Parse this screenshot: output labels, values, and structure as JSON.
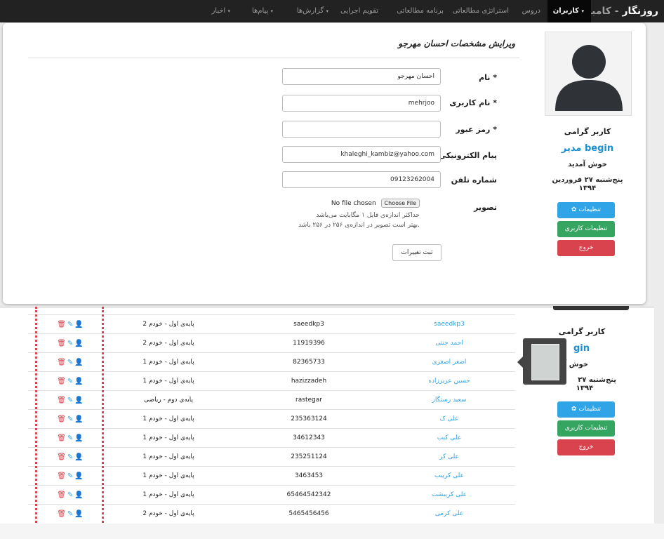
{
  "nav": {
    "brand_main": "روزنگار",
    "brand_sub": " - کامبیز",
    "items": [
      {
        "label": "کاربران",
        "caret": "▾",
        "active": true
      },
      {
        "label": "دروس",
        "caret": ""
      },
      {
        "label": "استراتژی مطالعاتی",
        "caret": ""
      },
      {
        "label": "برنامه مطالعاتی",
        "caret": ""
      },
      {
        "label": "تقویم اجرایی",
        "caret": ""
      },
      {
        "label": "گزارش‌ها",
        "caret": "▾"
      },
      {
        "label": "پیام‌ها",
        "caret": "▾"
      },
      {
        "label": "اخبار",
        "caret": "▾"
      }
    ]
  },
  "sidebar": {
    "greeting": "کاربر گرامی",
    "role": "مدیر begin",
    "welcome": "خوش آمدید",
    "date_line1": "پنج‌شنبه ۲۷ فروردین",
    "date_line2": "۱۳۹۴",
    "settings_label": "✿ تنظیمات",
    "user_settings_label": "تنظیمات کاربری",
    "logout_label": "خروج"
  },
  "form": {
    "title": "ویرایش مشخصات احسان مهرجو",
    "name_label": "نام *",
    "name_value": "احسان مهرجو",
    "username_label": "نام کاربری *",
    "username_value": "mehrjoo",
    "password_label": "رمز عبور *",
    "password_value": "",
    "email_label": "پیام الکترونیکی",
    "email_value": "khaleghi_kambiz@yahoo.com",
    "phone_label": "شماره تلفن",
    "phone_value": "09123262004",
    "image_label": "تصویر",
    "file_status": "No file chosen",
    "file_button": "Choose File",
    "hint1": "حداکثر اندازه‌ی فایل ۱ مگابایت می‌باشد",
    "hint2": "بهتر است تصویر در اندازه‌ی ۲۵۶ در ۲۵۶ باشد.",
    "submit_label": "ثبت تغییرات"
  },
  "sidebar2": {
    "greeting": "کاربر گرامی",
    "role_partial": "gin",
    "welcome_partial": "خوش آمد",
    "date_partial": "پنج‌شنبه ۲۷",
    "year": "۱۳۹۴",
    "settings_label": "✿ تنظیمات",
    "user_settings_label": "تنظیمات کاربری",
    "logout_label": "خروج"
  },
  "users_table": {
    "rows": [
      {
        "name": "saeedkp3",
        "username": "saeedkp3",
        "group": "پایه‌ی اول - خودم 2"
      },
      {
        "name": "احمد جنتی",
        "username": "11919396",
        "group": "پایه‌ی اول - خودم 2"
      },
      {
        "name": "اصغر اصغری",
        "username": "82365733",
        "group": "پایه‌ی اول - خودم 1"
      },
      {
        "name": "حسین عزیززاده",
        "username": "hazizzadeh",
        "group": "پایه‌ی اول - خودم 1"
      },
      {
        "name": "سعید رستگار",
        "username": "rastegar",
        "group": "پایه‌ی دوم - ریاضی"
      },
      {
        "name": "علی ک",
        "username": "235363124",
        "group": "پایه‌ی اول - خودم 1"
      },
      {
        "name": "علی کبب",
        "username": "34612343",
        "group": "پایه‌ی اول - خودم 1"
      },
      {
        "name": "علی کر",
        "username": "235251124",
        "group": "پایه‌ی اول - خودم 1"
      },
      {
        "name": "علی کریبب",
        "username": "3463453",
        "group": "پایه‌ی اول - خودم 1"
      },
      {
        "name": "علی کریبشت",
        "username": "65464542342",
        "group": "پایه‌ی اول - خودم 1"
      },
      {
        "name": "علی کرمی",
        "username": "5465456456",
        "group": "پایه‌ی اول - خودم 2"
      }
    ],
    "icons": [
      "user-icon",
      "edit-icon",
      "trash-icon"
    ]
  },
  "colors": {
    "navbar": "#222222",
    "link": "#2fa4e7",
    "danger": "#d9434e",
    "success": "#36a561"
  }
}
